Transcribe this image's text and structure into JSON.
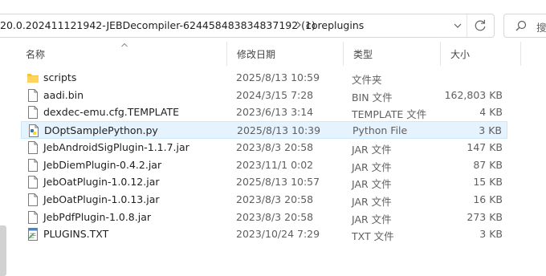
{
  "address_bar": {
    "path_segment": "20.0.202411121942-JEBDecompiler-624458483834837192 (1)",
    "separator": "›",
    "current_folder": "coreplugins"
  },
  "search": {
    "placeholder": "搜"
  },
  "columns": {
    "name": "名称",
    "modified": "修改日期",
    "type": "类型",
    "size": "大小"
  },
  "files": [
    {
      "name": "scripts",
      "modified": "2025/8/13 10:59",
      "type": "文件夹",
      "size": "",
      "icon": "folder-icon",
      "selected": false
    },
    {
      "name": "aadi.bin",
      "modified": "2024/3/15 7:28",
      "type": "BIN 文件",
      "size": "162,803 KB",
      "icon": "file-icon",
      "selected": false
    },
    {
      "name": "dexdec-emu.cfg.TEMPLATE",
      "modified": "2023/6/13 3:14",
      "type": "TEMPLATE 文件",
      "size": "4 KB",
      "icon": "file-icon",
      "selected": false
    },
    {
      "name": "DOptSamplePython.py",
      "modified": "2025/8/13 10:39",
      "type": "Python File",
      "size": "3 KB",
      "icon": "python-file-icon",
      "selected": true
    },
    {
      "name": "JebAndroidSigPlugin-1.1.7.jar",
      "modified": "2023/8/3 20:58",
      "type": "JAR 文件",
      "size": "147 KB",
      "icon": "file-icon",
      "selected": false
    },
    {
      "name": "JebDiemPlugin-0.4.2.jar",
      "modified": "2023/11/1 0:02",
      "type": "JAR 文件",
      "size": "87 KB",
      "icon": "file-icon",
      "selected": false
    },
    {
      "name": "JebOatPlugin-1.0.12.jar",
      "modified": "2025/8/13 10:57",
      "type": "JAR 文件",
      "size": "15 KB",
      "icon": "file-icon",
      "selected": false
    },
    {
      "name": "JebOatPlugin-1.0.13.jar",
      "modified": "2023/8/3 20:58",
      "type": "JAR 文件",
      "size": "16 KB",
      "icon": "file-icon",
      "selected": false
    },
    {
      "name": "JebPdfPlugin-1.0.8.jar",
      "modified": "2023/8/3 20:58",
      "type": "JAR 文件",
      "size": "273 KB",
      "icon": "file-icon",
      "selected": false
    },
    {
      "name": "PLUGINS.TXT",
      "modified": "2023/10/24 7:29",
      "type": "TXT 文件",
      "size": "3 KB",
      "icon": "text-file-icon",
      "selected": false
    }
  ],
  "colors": {
    "selection_bg": "#e5f3ff",
    "selection_border": "#cce8ff",
    "folder": "#f5c242"
  }
}
